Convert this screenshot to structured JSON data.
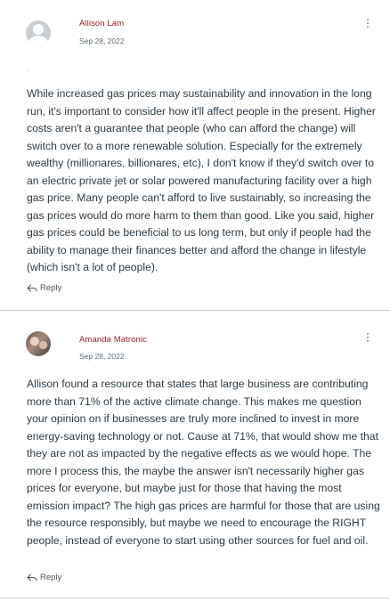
{
  "posts": [
    {
      "author": "Allison Lam",
      "date": "Sep 28, 2022",
      "avatar": "default-user-avatar",
      "body": "While increased gas prices may sustainability and innovation in the long run, it's important to consider how it'll affect people in the present. Higher costs aren't a guarantee that people (who can afford the change) will switch over to a more renewable solution. Especially for the extremely wealthy (millionares, billionares, etc),  I don't know if they'd switch over to an electric private jet or solar powered manufacturing facility over a high gas price. Many people can't afford to live sustainably, so increasing the gas prices would do more harm to them than good. Like you said, higher gas prices could be beneficial to us long term, but only if people had the ability to manage their finances better and afford the change in lifestyle (which isn't a lot of people).",
      "reply_label": "Reply"
    },
    {
      "author": "Amanda Matronic",
      "date": "Sep 28, 2022",
      "avatar": "user-photo-avatar",
      "body": "Allison found a resource that states that large business are contributing more than 71% of the active climate change. This makes me question your opinion on if businesses are truly more inclined to invest in more energy-saving technology or not. Cause at 71%, that would show me that they are not as impacted by the negative effects as we would hope. The more I process this, the maybe the answer isn't necessarily higher gas prices for everyone, but maybe just for those that having the most emission impact? The high gas prices are harmful for those that are using the resource responsibly, but maybe we need to encourage the RIGHT people, instead of everyone to start using other sources for fuel and oil.",
      "reply_label": "Reply"
    }
  ],
  "colors": {
    "author": "#a61d2b",
    "text": "#2d3b45",
    "meta": "#5d6b75",
    "divider": "#c7cdd1"
  },
  "icons": {
    "reply": "reply-arrow-icon",
    "menu": "kebab-menu-icon"
  }
}
